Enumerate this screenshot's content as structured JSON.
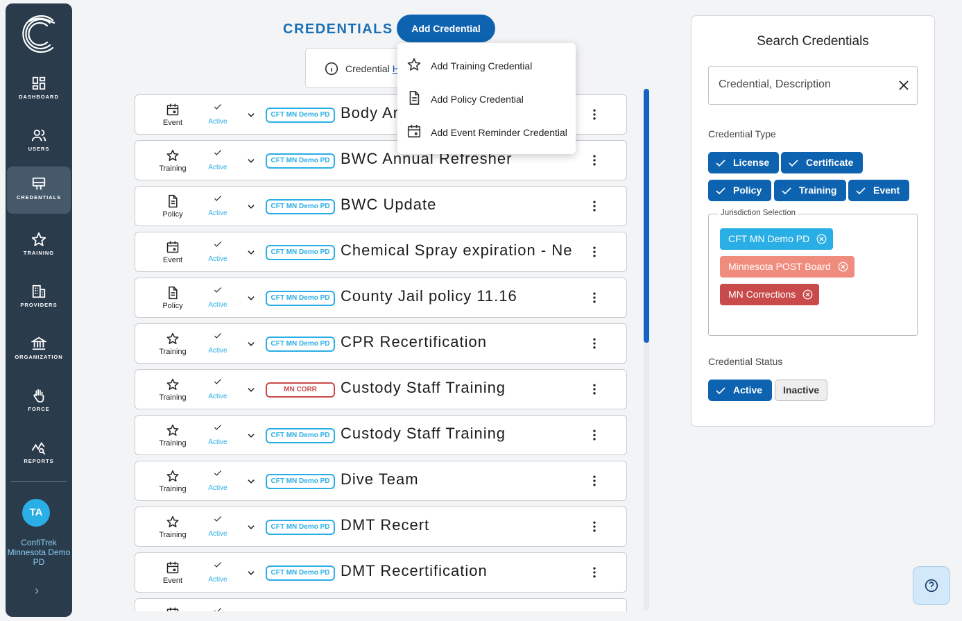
{
  "sidebar": {
    "items": [
      {
        "label": "DASHBOARD",
        "icon": "dashboard-icon"
      },
      {
        "label": "USERS",
        "icon": "users-icon"
      },
      {
        "label": "CREDENTIALS",
        "icon": "credentials-icon",
        "active": true
      },
      {
        "label": "TRAINING",
        "icon": "star-icon"
      },
      {
        "label": "PROVIDERS",
        "icon": "building-icon"
      },
      {
        "label": "ORGANIZATION",
        "icon": "bank-icon"
      },
      {
        "label": "FORCE",
        "icon": "hand-icon"
      },
      {
        "label": "REPORTS",
        "icon": "chart-search-icon"
      }
    ],
    "avatar_initials": "TA",
    "org_name": "ConfiTrek Minnesota Demo PD"
  },
  "header": {
    "title": "CREDENTIALS",
    "add_button": "Add Credential",
    "info_text": "Credential ",
    "info_link": "H"
  },
  "dropdown": {
    "items": [
      {
        "label": "Add Training Credential",
        "icon": "star-outline-icon"
      },
      {
        "label": "Add Policy Credential",
        "icon": "document-icon"
      },
      {
        "label": "Add Event Reminder Credential",
        "icon": "calendar-event-icon"
      }
    ]
  },
  "credentials": [
    {
      "type": "Event",
      "status": "Active",
      "jurisdiction": "CFT MN Demo PD",
      "name": "Body Ar"
    },
    {
      "type": "Training",
      "status": "Active",
      "jurisdiction": "CFT MN Demo PD",
      "name": "BWC Annual Refresher"
    },
    {
      "type": "Policy",
      "status": "Active",
      "jurisdiction": "CFT MN Demo PD",
      "name": "BWC Update"
    },
    {
      "type": "Event",
      "status": "Active",
      "jurisdiction": "CFT MN Demo PD",
      "name": "Chemical Spray expiration - Ne"
    },
    {
      "type": "Policy",
      "status": "Active",
      "jurisdiction": "CFT MN Demo PD",
      "name": "County Jail policy 11.16"
    },
    {
      "type": "Training",
      "status": "Active",
      "jurisdiction": "CFT MN Demo PD",
      "name": "CPR Recertification"
    },
    {
      "type": "Training",
      "status": "Active",
      "jurisdiction": "MN CORR",
      "name": "Custody Staff Training"
    },
    {
      "type": "Training",
      "status": "Active",
      "jurisdiction": "CFT MN Demo PD",
      "name": "Custody Staff Training"
    },
    {
      "type": "Training",
      "status": "Active",
      "jurisdiction": "CFT MN Demo PD",
      "name": "Dive Team"
    },
    {
      "type": "Training",
      "status": "Active",
      "jurisdiction": "CFT MN Demo PD",
      "name": "DMT Recert"
    },
    {
      "type": "Event",
      "status": "Active",
      "jurisdiction": "CFT MN Demo PD",
      "name": "DMT Recertification"
    },
    {
      "type": "Event",
      "status": "",
      "jurisdiction": "",
      "name": ""
    }
  ],
  "search": {
    "title": "Search Credentials",
    "placeholder": "Credential, Description",
    "type_label": "Credential Type",
    "types": [
      {
        "label": "License",
        "selected": true
      },
      {
        "label": "Certificate",
        "selected": true
      },
      {
        "label": "Policy",
        "selected": true
      },
      {
        "label": "Training",
        "selected": true
      },
      {
        "label": "Event",
        "selected": true
      }
    ],
    "jurisdiction_label": "Jurisdiction Selection",
    "jurisdictions": [
      {
        "label": "CFT MN Demo PD",
        "color": "#2aaee6"
      },
      {
        "label": "Minnesota POST Board",
        "color": "#f08c7e"
      },
      {
        "label": "MN Corrections",
        "color": "#c94a4a"
      }
    ],
    "status_label": "Credential Status",
    "statuses": [
      {
        "label": "Active",
        "selected": true
      },
      {
        "label": "Inactive",
        "selected": false
      }
    ]
  },
  "colors": {
    "primary": "#0d63b0",
    "sidebar": "#2a3b4c",
    "accent": "#2aaee6",
    "red": "#c94a4a"
  }
}
